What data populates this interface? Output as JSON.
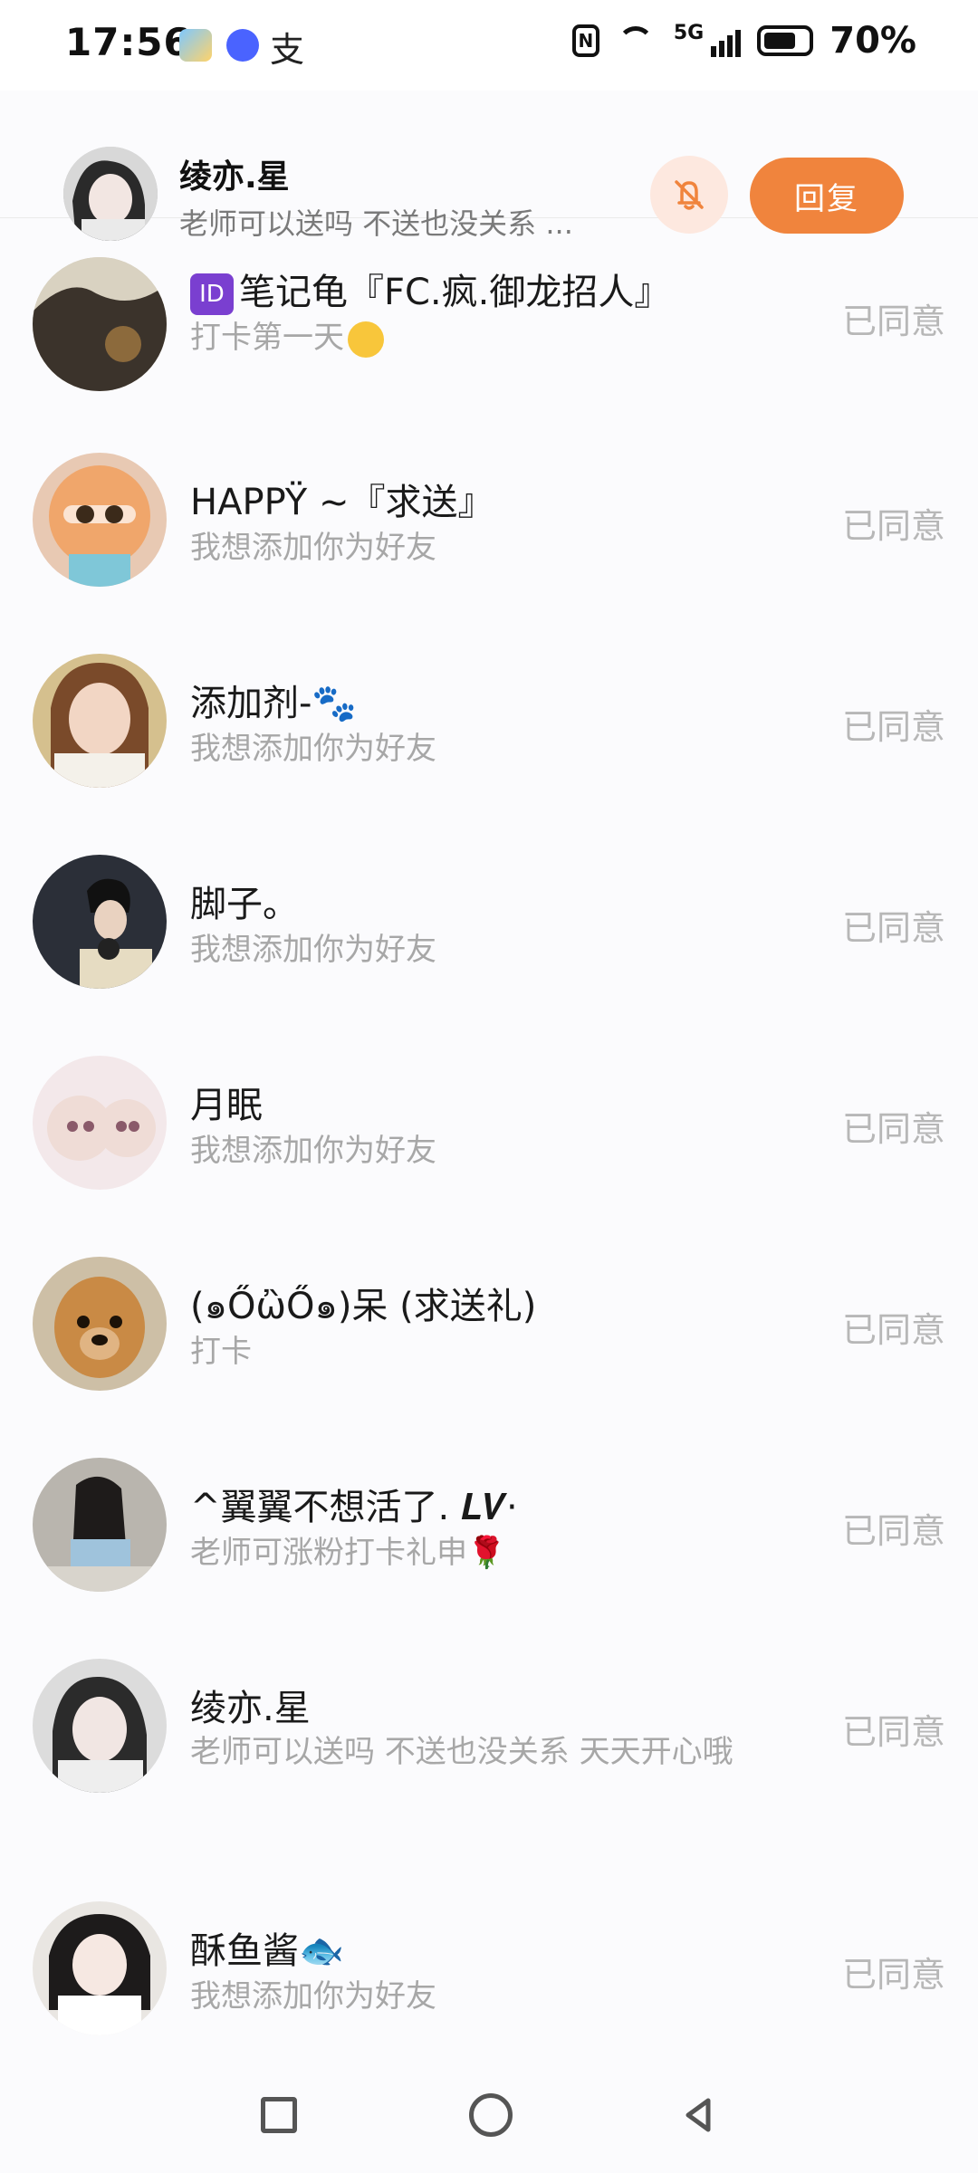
{
  "status_bar": {
    "time": "17:56",
    "alipay_glyph": "支",
    "battery": "70%",
    "network": "5G",
    "icons": [
      "weather-icon",
      "music-icon",
      "alipay-icon",
      "nfc-icon",
      "wifi-icon",
      "signal-icon",
      "battery-icon"
    ]
  },
  "header": {
    "name": "绫亦.星",
    "message": "老师可以送吗 不送也没关系 ...",
    "reply_label": "回复",
    "mute_icon": "bell-off-icon",
    "accent": "#f0843d"
  },
  "requests": [
    {
      "name": "笔记龟『FC.疯.御龙招人』",
      "badge": "ID",
      "sub": "打卡第一天",
      "sub_emoji": "kissing-face-icon",
      "status": "已同意"
    },
    {
      "name": "HAPPŸ ~『求送』",
      "sub": "我想添加你为好友",
      "status": "已同意"
    },
    {
      "name": "添加剂-🐾",
      "sub": "我想添加你为好友",
      "status": "已同意"
    },
    {
      "name": "脚子。",
      "sub": "我想添加你为好友",
      "status": "已同意"
    },
    {
      "name": "月眠",
      "sub": "我想添加你为好友",
      "status": "已同意"
    },
    {
      "name": "(๑ŐὢŐ๑)呆 (求送礼)",
      "sub": "打卡",
      "status": "已同意"
    },
    {
      "name": "^翼翼不想活了. 𝑳𝑽·",
      "sub": "老师可涨粉打卡礼申🌹",
      "status": "已同意"
    },
    {
      "name": "绫亦.星",
      "sub": "老师可以送吗 不送也没关系 天天开心哦",
      "status": "已同意"
    },
    {
      "name": "酥鱼酱🐟",
      "sub": "我想添加你为好友",
      "status": "已同意"
    }
  ],
  "nav": {
    "recent_icon": "square-icon",
    "home_icon": "circle-icon",
    "back_icon": "triangle-back-icon"
  }
}
